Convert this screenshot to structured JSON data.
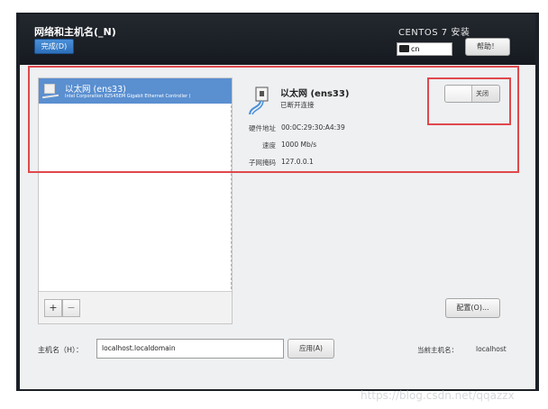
{
  "header": {
    "title": "网络和主机名(_N)",
    "done_label": "完成(D)",
    "install_title": "CENTOS 7 安装",
    "keyboard_layout": "cn",
    "help_label": "帮助！"
  },
  "connections": {
    "items": [
      {
        "name": "以太网 (ens33)",
        "description": "Intel Corporation 82545EM Gigabit Ethernet Controller ("
      }
    ],
    "add_label": "+",
    "remove_label": "−"
  },
  "detail": {
    "title": "以太网 (ens33)",
    "status": "已断开连接",
    "toggle_label": "关闭",
    "hw_label": "硬件地址",
    "hw_value": "00:0C:29:30:A4:39",
    "speed_label": "速度",
    "speed_value": "1000 Mb/s",
    "mask_label": "子网掩码",
    "mask_value": "127.0.0.1",
    "config_label": "配置(O)..."
  },
  "hostname": {
    "label": "主机名（H）：",
    "value": "localhost.localdomain",
    "apply_label": "应用(A)",
    "current_label": "当前主机名：",
    "current_value": "localhost"
  },
  "watermark": "https://blog.csdn.net/qqazzx",
  "colors": {
    "accent_blue": "#4a90d9",
    "selection": "#5a8fd0",
    "annotation_red": "#e0484c",
    "header_bg": "#1b1f26"
  }
}
